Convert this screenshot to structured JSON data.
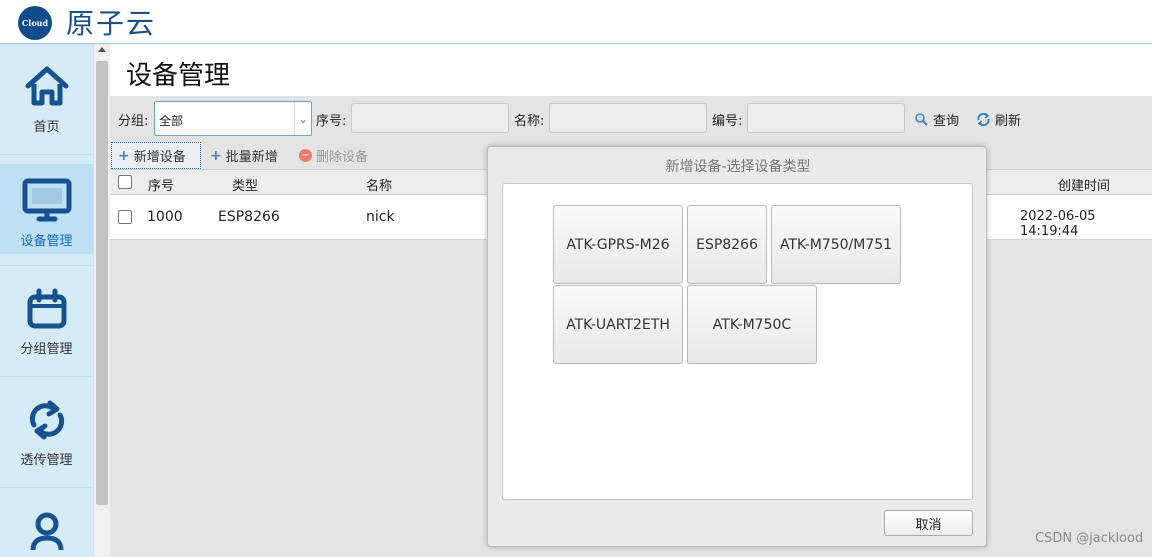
{
  "app": {
    "logo_text": "Cloud",
    "brand": "原子云"
  },
  "sidebar": {
    "items": [
      {
        "label": "首页",
        "icon": "home-icon"
      },
      {
        "label": "设备管理",
        "icon": "monitor-icon",
        "active": true
      },
      {
        "label": "分组管理",
        "icon": "calendar-icon"
      },
      {
        "label": "透传管理",
        "icon": "sync-icon"
      },
      {
        "label": "",
        "icon": "user-icon"
      }
    ]
  },
  "page": {
    "title": "设备管理"
  },
  "filters": {
    "group_label": "分组:",
    "group_value": "全部",
    "serial_label": "序号:",
    "serial_value": "",
    "name_label": "名称:",
    "name_value": "",
    "code_label": "编号:",
    "code_value": "",
    "query_label": "查询",
    "refresh_label": "刷新"
  },
  "toolbar": {
    "add_label": "新增设备",
    "batch_add_label": "批量新增",
    "delete_label": "删除设备"
  },
  "table": {
    "columns": {
      "serial": "序号",
      "type": "类型",
      "name": "名称",
      "created": "创建时间"
    },
    "rows": [
      {
        "serial": "1000",
        "type": "ESP8266",
        "name": "nick",
        "created": "2022-06-05 14:19:44"
      }
    ]
  },
  "dialog": {
    "title": "新增设备-选择设备类型",
    "types": [
      "ATK-GPRS-M26",
      "ESP8266",
      "ATK-M750/M751",
      "ATK-UART2ETH",
      "ATK-M750C"
    ],
    "cancel_label": "取消"
  },
  "watermark": "CSDN @jacklood",
  "colors": {
    "brand": "#1b4f8a",
    "sidebar_bg": "#d6ebf8",
    "active_text": "#1a6ab8",
    "icon_blue": "#15528f"
  }
}
